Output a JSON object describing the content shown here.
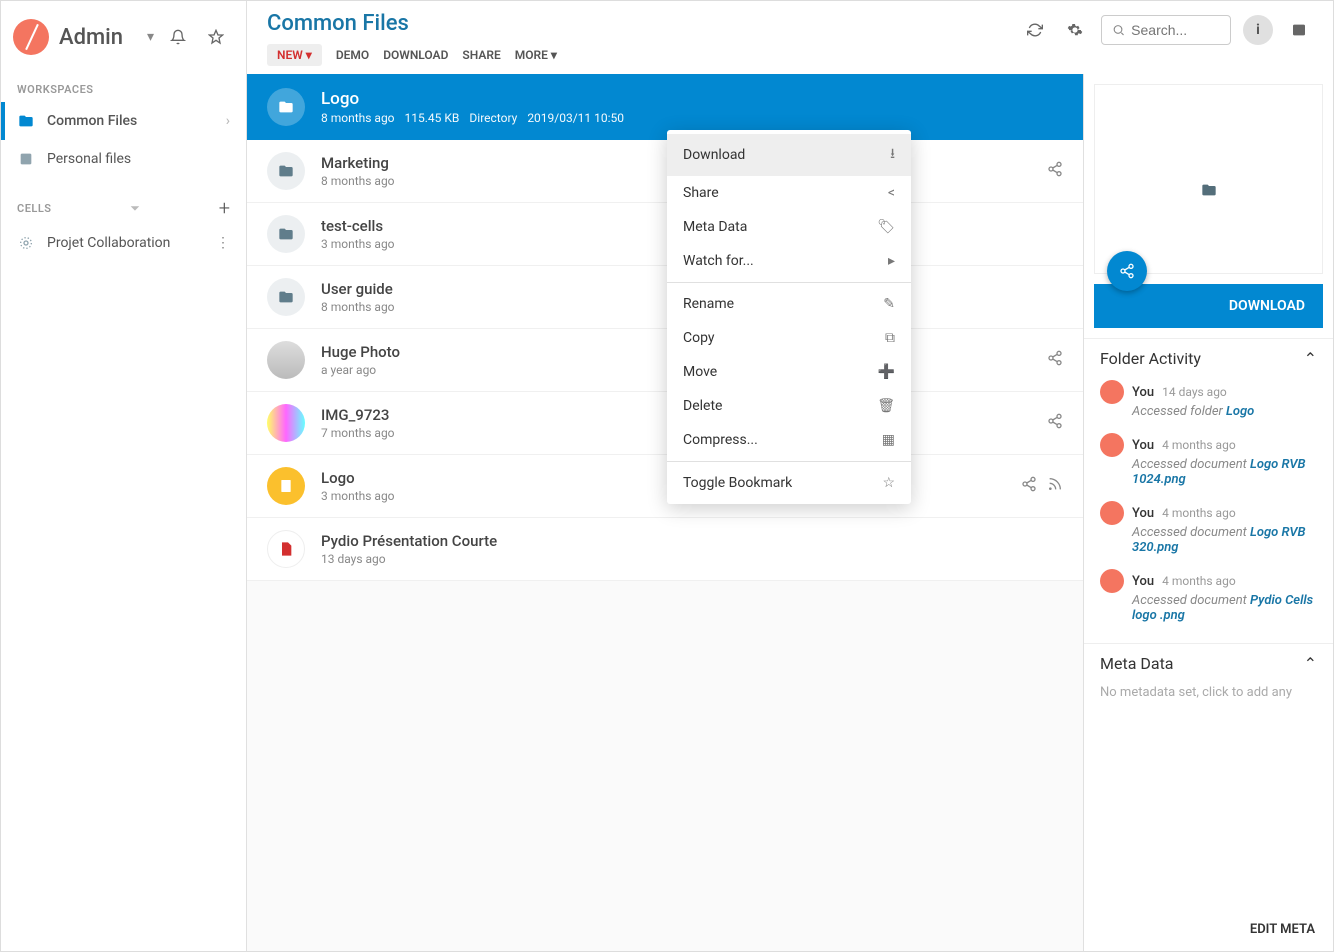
{
  "user": {
    "name": "Admin"
  },
  "sidebar": {
    "workspaces_label": "WORKSPACES",
    "cells_label": "CELLS",
    "workspaces": [
      {
        "label": "Common Files",
        "icon": "folder",
        "active": true,
        "arrow": true
      },
      {
        "label": "Personal files",
        "icon": "person",
        "active": false
      }
    ],
    "cells": [
      {
        "label": "Projet Collaboration",
        "icon": "cell"
      }
    ]
  },
  "header": {
    "title": "Common Files",
    "toolbar": {
      "new": "NEW",
      "items": [
        "DEMO",
        "DOWNLOAD",
        "SHARE",
        "MORE"
      ]
    },
    "search_placeholder": "Search..."
  },
  "selected": {
    "name": "Logo",
    "age": "8 months ago",
    "size": "115.45 KB",
    "type": "Directory",
    "date": "2019/03/11 10:50"
  },
  "files": [
    {
      "name": "Marketing",
      "time": "8 months ago",
      "icon": "folder",
      "share": true
    },
    {
      "name": "test-cells",
      "time": "3 months ago",
      "icon": "folder"
    },
    {
      "name": "User guide",
      "time": "8 months ago",
      "icon": "folder"
    },
    {
      "name": "Huge Photo",
      "time": "a year ago",
      "icon": "image",
      "share": true
    },
    {
      "name": "IMG_9723",
      "time": "7 months ago",
      "icon": "image2",
      "share": true
    },
    {
      "name": "Logo",
      "time": "3 months ago",
      "icon": "zip",
      "share": true,
      "rss": true
    },
    {
      "name": "Pydio Présentation Courte",
      "time": "13 days ago",
      "icon": "pdf"
    }
  ],
  "context_menu": {
    "group1": [
      {
        "label": "Download",
        "icon": "download",
        "hover": true
      },
      {
        "label": "Share",
        "icon": "share"
      },
      {
        "label": "Meta Data",
        "icon": "tag"
      },
      {
        "label": "Watch for...",
        "icon": "chevron-right"
      }
    ],
    "group2": [
      {
        "label": "Rename",
        "icon": "edit"
      },
      {
        "label": "Copy",
        "icon": "copy"
      },
      {
        "label": "Move",
        "icon": "move"
      },
      {
        "label": "Delete",
        "icon": "trash"
      },
      {
        "label": "Compress...",
        "icon": "compress"
      }
    ],
    "group3": [
      {
        "label": "Toggle Bookmark",
        "icon": "star"
      }
    ]
  },
  "rightpanel": {
    "download_label": "DOWNLOAD",
    "activity_title": "Folder Activity",
    "activities": [
      {
        "user": "You",
        "time": "14 days ago",
        "desc_prefix": "Accessed folder ",
        "desc_link": "Logo"
      },
      {
        "user": "You",
        "time": "4 months ago",
        "desc_prefix": "Accessed document ",
        "desc_link": "Logo RVB 1024.png"
      },
      {
        "user": "You",
        "time": "4 months ago",
        "desc_prefix": "Accessed document ",
        "desc_link": "Logo RVB 320.png"
      },
      {
        "user": "You",
        "time": "4 months ago",
        "desc_prefix": "Accessed document ",
        "desc_link": "Pydio Cells logo .png"
      }
    ],
    "meta_title": "Meta Data",
    "meta_empty": "No metadata set, click to add any",
    "edit_meta": "EDIT META"
  }
}
